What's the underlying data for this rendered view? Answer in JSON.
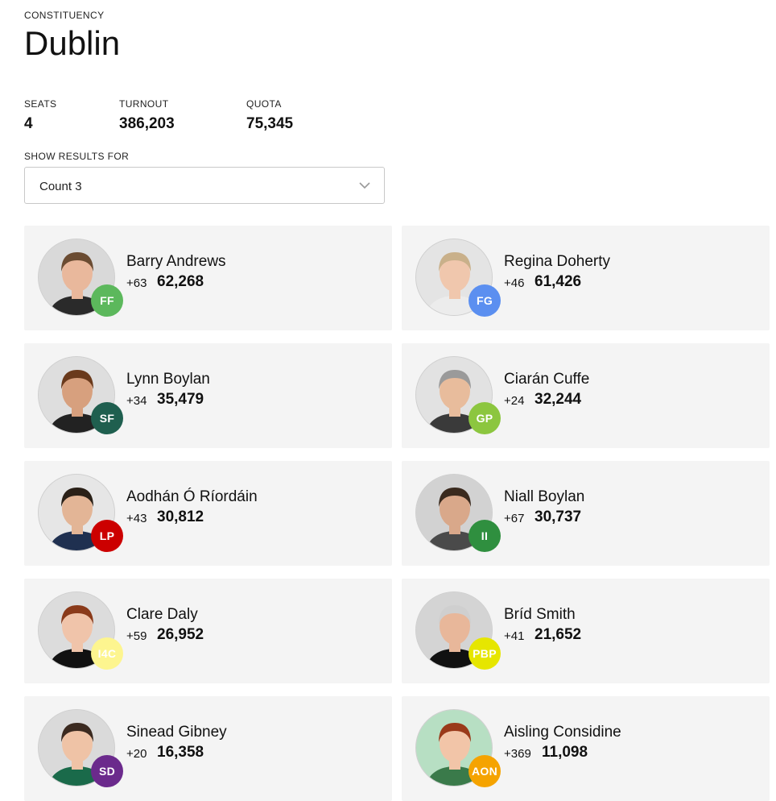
{
  "header": {
    "eyebrow": "CONSTITUENCY",
    "title": "Dublin"
  },
  "stats": [
    {
      "label": "SEATS",
      "value": "4"
    },
    {
      "label": "TURNOUT",
      "value": "386,203"
    },
    {
      "label": "QUOTA",
      "value": "75,345"
    }
  ],
  "results_selector": {
    "label": "SHOW RESULTS FOR",
    "selected": "Count 3",
    "icon": "chevron-down-icon"
  },
  "candidates": [
    {
      "name": "Barry Andrews",
      "change": "+63",
      "votes": "62,268",
      "party": "FF",
      "party_color": "#5cb85c",
      "photo_bg": "#d9d9d9",
      "skin": "#e9b89c",
      "hair": "#6b4c32",
      "shirt": "#2a2a2a"
    },
    {
      "name": "Regina Doherty",
      "change": "+46",
      "votes": "61,426",
      "party": "FG",
      "party_color": "#5b8ff0",
      "photo_bg": "#e4e4e4",
      "skin": "#f0c7ad",
      "hair": "#c9b08a",
      "shirt": "#ececec"
    },
    {
      "name": "Lynn Boylan",
      "change": "+34",
      "votes": "35,479",
      "party": "SF",
      "party_color": "#1f5f4f",
      "photo_bg": "#dedede",
      "skin": "#d7a07e",
      "hair": "#6a3a1c",
      "shirt": "#222222"
    },
    {
      "name": "Ciarán Cuffe",
      "change": "+24",
      "votes": "32,244",
      "party": "GP",
      "party_color": "#8cc63f",
      "photo_bg": "#e2e2e2",
      "skin": "#e8bc9c",
      "hair": "#9a9a9a",
      "shirt": "#3a3a3a"
    },
    {
      "name": "Aodhán Ó Ríordáin",
      "change": "+43",
      "votes": "30,812",
      "party": "LP",
      "party_color": "#cc0000",
      "photo_bg": "#e6e6e6",
      "skin": "#e3b596",
      "hair": "#2a2017",
      "shirt": "#1f3050"
    },
    {
      "name": "Niall Boylan",
      "change": "+67",
      "votes": "30,737",
      "party": "II",
      "party_color": "#2f8f3f",
      "photo_bg": "#d2d2d2",
      "skin": "#d9a88a",
      "hair": "#3a2a1e",
      "shirt": "#4a4a4a"
    },
    {
      "name": "Clare Daly",
      "change": "+59",
      "votes": "26,952",
      "party": "I4C",
      "party_color": "#fdf58f",
      "photo_bg": "#dcdcdc",
      "skin": "#f0c4aa",
      "hair": "#8a3a1a",
      "shirt": "#111111"
    },
    {
      "name": "Bríd Smith",
      "change": "+41",
      "votes": "21,652",
      "party": "PBP",
      "party_color": "#e6e600",
      "photo_bg": "#d4d4d4",
      "skin": "#e8b79a",
      "hair": "#cfcfcf",
      "shirt": "#111111"
    },
    {
      "name": "Sinead Gibney",
      "change": "+20",
      "votes": "16,358",
      "party": "SD",
      "party_color": "#6b2a8c",
      "photo_bg": "#dadada",
      "skin": "#efc3a6",
      "hair": "#3b2a20",
      "shirt": "#1a6a4a"
    },
    {
      "name": "Aisling Considine",
      "change": "+369",
      "votes": "11,098",
      "party": "AON",
      "party_color": "#f5a300",
      "photo_bg": "#b7dfc3",
      "skin": "#f2c5a8",
      "hair": "#9a3a1a",
      "shirt": "#3a7a4a"
    }
  ]
}
